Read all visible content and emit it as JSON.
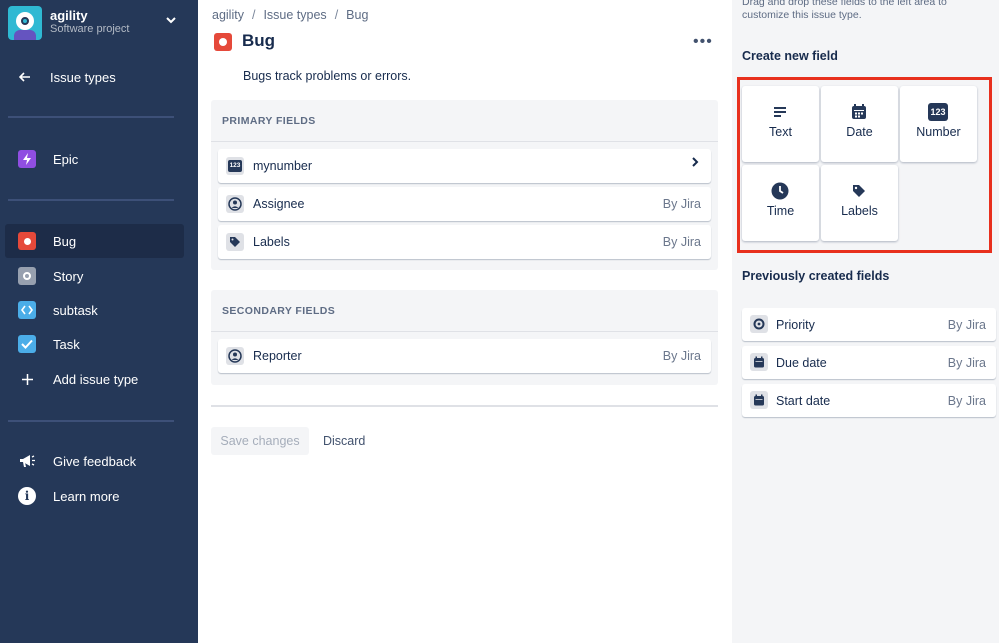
{
  "project": {
    "name": "agility",
    "type": "Software project"
  },
  "sidebar": {
    "back_label": "Issue types",
    "epic_label": "Epic",
    "items": [
      {
        "label": "Bug",
        "icon": "bug-icon",
        "color": "#e5493a"
      },
      {
        "label": "Story",
        "icon": "story-icon",
        "color": "#97a0af"
      },
      {
        "label": "subtask",
        "icon": "subtask-icon",
        "color": "#4bade8"
      },
      {
        "label": "Task",
        "icon": "task-icon",
        "color": "#4bade8"
      }
    ],
    "add_label": "Add issue type",
    "feedback_label": "Give feedback",
    "learn_label": "Learn more"
  },
  "breadcrumb": {
    "project": "agility",
    "section": "Issue types",
    "current": "Bug"
  },
  "page": {
    "title": "Bug",
    "more": "•••",
    "description": "Bugs track problems or errors."
  },
  "primary": {
    "title": "PRIMARY FIELDS",
    "fields": [
      {
        "label": "mynumber",
        "source": "",
        "icon": "number-icon"
      },
      {
        "label": "Assignee",
        "source": "By Jira",
        "icon": "person-icon"
      },
      {
        "label": "Labels",
        "source": "By Jira",
        "icon": "tag-icon"
      }
    ]
  },
  "secondary": {
    "title": "SECONDARY FIELDS",
    "fields": [
      {
        "label": "Reporter",
        "source": "By Jira",
        "icon": "person-icon"
      }
    ]
  },
  "actions": {
    "save": "Save changes",
    "discard": "Discard"
  },
  "panel": {
    "hint": "Drag and drop these fields to the left area to customize this issue type.",
    "create_heading": "Create new field",
    "tiles": [
      {
        "label": "Text",
        "icon": "text-icon"
      },
      {
        "label": "Date",
        "icon": "calendar-icon"
      },
      {
        "label": "Number",
        "icon": "number-icon",
        "glyph": "123"
      },
      {
        "label": "Time",
        "icon": "clock-icon"
      },
      {
        "label": "Labels",
        "icon": "tag-icon"
      }
    ],
    "previous_heading": "Previously created fields",
    "previous": [
      {
        "label": "Priority",
        "source": "By Jira",
        "icon": "priority-icon"
      },
      {
        "label": "Due date",
        "source": "By Jira",
        "icon": "calendar-icon"
      },
      {
        "label": "Start date",
        "source": "By Jira",
        "icon": "calendar-icon"
      }
    ]
  },
  "colors": {
    "sidebar": "#253858",
    "accent_red": "#e5493a",
    "highlight": "#e8301e",
    "epic": "#904ee2"
  }
}
